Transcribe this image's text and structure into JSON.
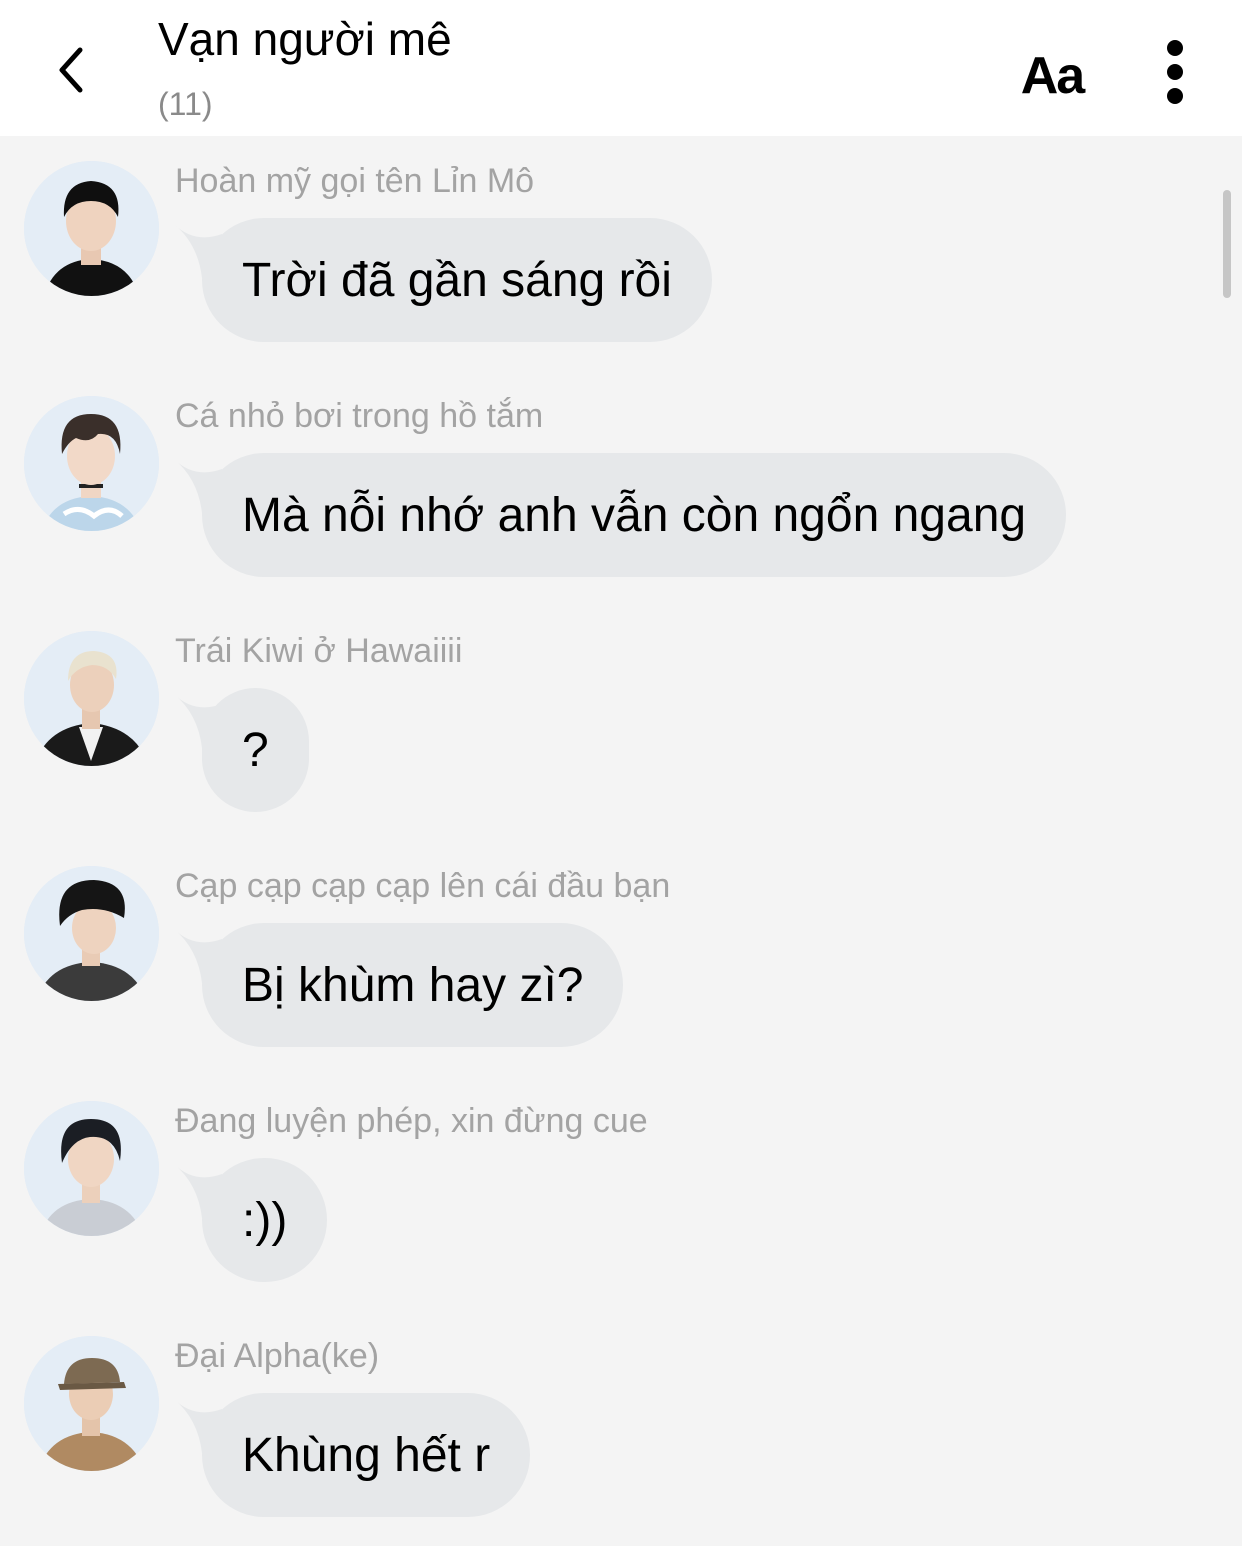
{
  "header": {
    "title": "Vạn người mê",
    "member_count": "(11)",
    "font_button": "Aa"
  },
  "messages": [
    {
      "sender": "Hoàn mỹ gọi tên Lỉn Mô",
      "text": "Trời đã gần sáng rồi"
    },
    {
      "sender": "Cá nhỏ bơi trong hồ tắm",
      "text": "Mà nỗi nhớ anh vẫn còn ngổn ngang"
    },
    {
      "sender": "Trái Kiwi ở Hawaiiii",
      "text": "?"
    },
    {
      "sender": "Cạp cạp cạp cạp lên cái đầu bạn",
      "text": "Bị khùm hay zì?"
    },
    {
      "sender": "Đang luyện phép, xin đừng cue",
      "text": ":))"
    },
    {
      "sender": "Đại Alpha(ke)",
      "text": "Khùng hết r"
    }
  ],
  "colors": {
    "background": "#f4f4f4",
    "header": "#ffffff",
    "bubble": "#e6e8ea",
    "sender_text": "#a3a3a3",
    "avatar_bg": "#dce8f3"
  }
}
